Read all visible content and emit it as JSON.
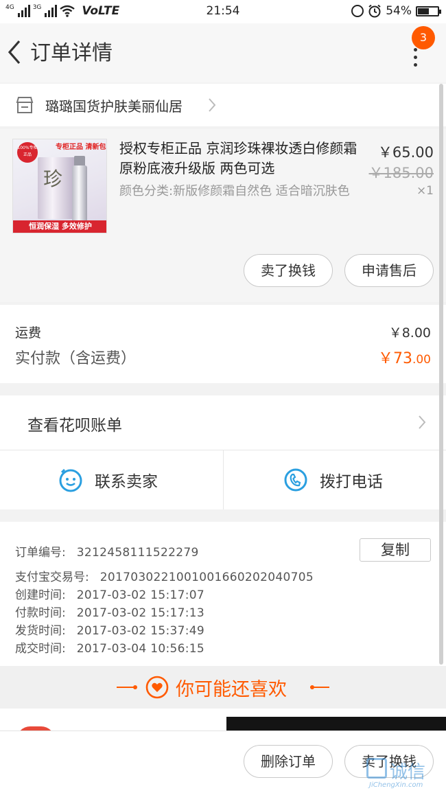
{
  "status_bar": {
    "network_left": "4G",
    "network_right": "3G",
    "volte": "VoLTE",
    "time": "21:54",
    "battery": "54%",
    "battery_level": 0.54
  },
  "nav": {
    "title": "订单详情",
    "badge_count": "3"
  },
  "shop": {
    "name": "璐璐国货护肤美丽仙居"
  },
  "product": {
    "title": "授权专柜正品 京润珍珠裸妆透白修颜霜 原粉底液升级版 两色可选",
    "sku": "颜色分类:新版修颜霜自然色 适合暗沉肤色",
    "price": "￥65.00",
    "original_price": "￥185.00",
    "quantity": "×1",
    "image_top_text": "专柜正品 清新包邮",
    "image_seal_text": "100%专柜正品",
    "image_box_char": "珍",
    "image_banner_text": "恒润保湿 多效修护",
    "sell_button": "卖了换钱",
    "after_sale_button": "申请售后"
  },
  "fees": {
    "shipping_label": "运费",
    "shipping_value": "￥8.00",
    "paid_label": "实付款（含运费）",
    "paid_int": "￥73",
    "paid_dec": ".00"
  },
  "huabei": {
    "label": "查看花呗账单"
  },
  "contact": {
    "seller_label": "联系卖家",
    "phone_label": "拨打电话"
  },
  "order_info": {
    "order_no_label": "订单编号:",
    "order_no": "3212458111522279",
    "copy_button": "复制",
    "alipay_label": "支付宝交易号:",
    "alipay_no": "2017030221001001660202040705",
    "created_label": "创建时间:",
    "created": "2017-03-02  15:17:07",
    "paid_label": "付款时间:",
    "paid": "2017-03-02  15:17:13",
    "shipped_label": "发货时间:",
    "shipped": "2017-03-02  15:37:49",
    "completed_label": "成交时间:",
    "completed": "2017-03-04  10:56:15"
  },
  "recommend": {
    "title": "你可能还喜欢"
  },
  "bottom_bar": {
    "delete_button": "删除订单",
    "sell_button": "卖了换钱"
  },
  "watermark": {
    "text": "诚信",
    "sub": "JiChengXin.com"
  },
  "colors": {
    "accent": "#ff5a00",
    "icon_blue": "#2a9fe0"
  }
}
